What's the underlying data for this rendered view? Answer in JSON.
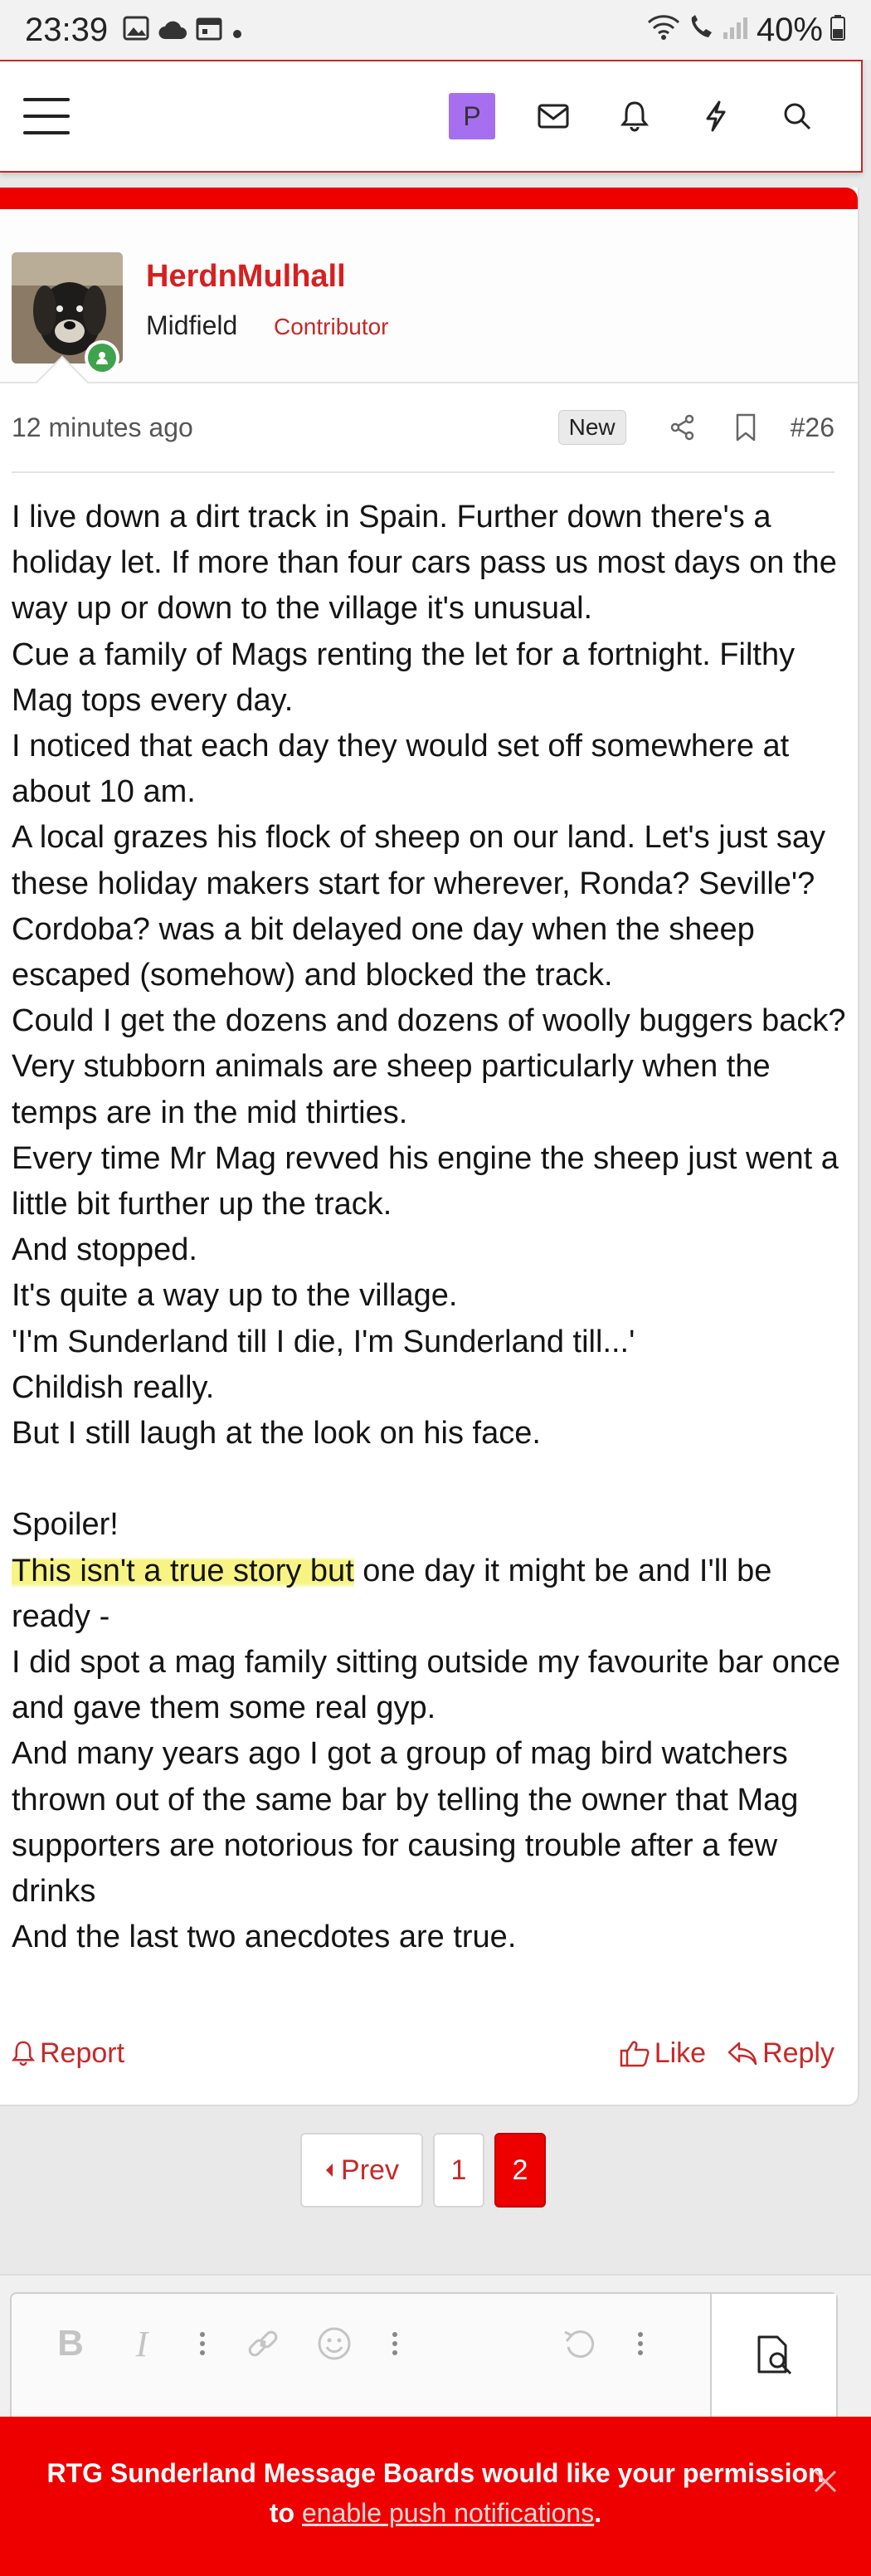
{
  "status_bar": {
    "time": "23:39",
    "battery": "40%"
  },
  "nav": {
    "avatar_letter": "P",
    "icons": [
      "menu-icon",
      "avatar",
      "envelope-icon",
      "bell-icon",
      "bolt-icon",
      "search-icon"
    ]
  },
  "post": {
    "username": "HerdnMulhall",
    "user_title": "Midfield",
    "user_badge": "Contributor",
    "time_ago": "12 minutes ago",
    "new_label": "New",
    "post_number": "#26",
    "lines": [
      "I live down a dirt track in Spain. Further down there's a holiday let. If more than four cars pass us most days on the way up or down to the village it's unusual.",
      "Cue a family of Mags renting the let for a fortnight. Filthy Mag tops every day.",
      "I noticed that each day they would set off somewhere at about 10 am.",
      "A local grazes his flock of sheep on our land. Let's just say these holiday makers start for wherever, Ronda? Seville'? Cordoba? was a bit delayed one day when the sheep escaped (somehow) and blocked the track.",
      "Could I get the dozens and dozens of woolly buggers back?",
      "Very stubborn animals are sheep particularly when the temps are in the mid thirties.",
      "Every time Mr Mag revved his engine the sheep just went a little bit further up the track.",
      "And stopped.",
      "It's quite a way up to the village.",
      "'I'm Sunderland till I die, I'm Sunderland till...'",
      "Childish really.",
      "But I still laugh at the look on his face."
    ],
    "spoiler_heading": "Spoiler!",
    "spoiler_highlight": "This isn't a true story but",
    "spoiler_rest": " one day it might be and I'll be ready -",
    "tail_lines": [
      "I did spot a mag family sitting outside my favourite bar once and gave them some real gyp.",
      "And many years ago I got a group of mag bird watchers thrown out of the same bar by telling the owner that Mag supporters are notorious for causing trouble after a few drinks",
      "And the last two anecdotes are true."
    ],
    "report_label": "Report",
    "like_label": "Like",
    "reply_label": "Reply"
  },
  "pagination": {
    "prev_label": "Prev",
    "pages": [
      "1",
      "2"
    ],
    "current": "2"
  },
  "editor": {
    "bold_glyph": "B",
    "italic_glyph": "I"
  },
  "push_banner": {
    "text": "RTG Sunderland Message Boards would like your permission",
    "to": "to ",
    "link": "enable push notifications",
    "end": "."
  },
  "colors": {
    "accent": "#ee0000",
    "link": "#c62828",
    "online": "#3fa34d",
    "highlight": "#f6f26e",
    "avatar_bg": "#a56ff0"
  }
}
